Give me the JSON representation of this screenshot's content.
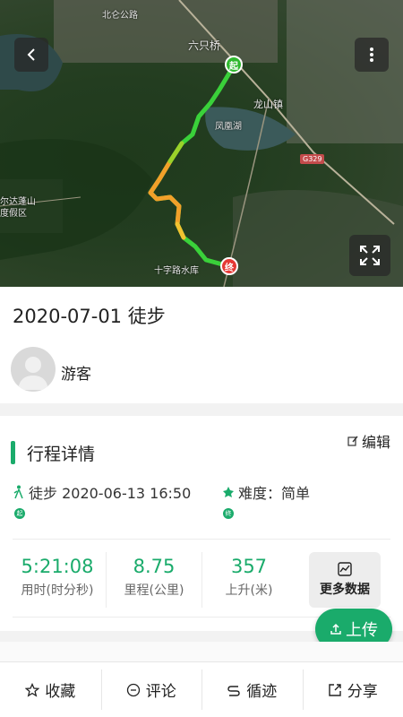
{
  "map": {
    "labels": {
      "town1": "六只桥",
      "town2": "龙山镇",
      "lake": "凤凰湖",
      "scenic": "尔达蓬山",
      "resort": "度假区",
      "reservoir": "十字路水库",
      "road": "G329",
      "top_town": "北仑公路"
    },
    "start_marker": "起",
    "end_marker": "终",
    "track_colors": [
      "#3ad13a",
      "#9bd12a",
      "#f2c230",
      "#f28a2a"
    ]
  },
  "trip": {
    "title": "2020-07-01 徒步",
    "user_name": "游客"
  },
  "details": {
    "section_title": "行程详情",
    "edit_label": "编辑",
    "activity": "徒步 2020-06-13 16:50",
    "difficulty": "难度：简单",
    "pin_a": "起",
    "pin_b": "终",
    "stats": [
      {
        "value": "5:21:08",
        "label": "用时(时分秒)"
      },
      {
        "value": "8.75",
        "label": "里程(公里)"
      },
      {
        "value": "357",
        "label": "上升(米)"
      }
    ],
    "more_data_label": "更多数据",
    "upload_label": "上传"
  },
  "bottom_bar": {
    "tabs": [
      {
        "label": "收藏",
        "icon": "star-icon"
      },
      {
        "label": "评论",
        "icon": "comment-icon"
      },
      {
        "label": "循迹",
        "icon": "route-icon"
      },
      {
        "label": "分享",
        "icon": "share-icon"
      }
    ]
  },
  "colors": {
    "accent": "#1aab6b",
    "start": "#2fb82f",
    "end": "#e53935"
  }
}
